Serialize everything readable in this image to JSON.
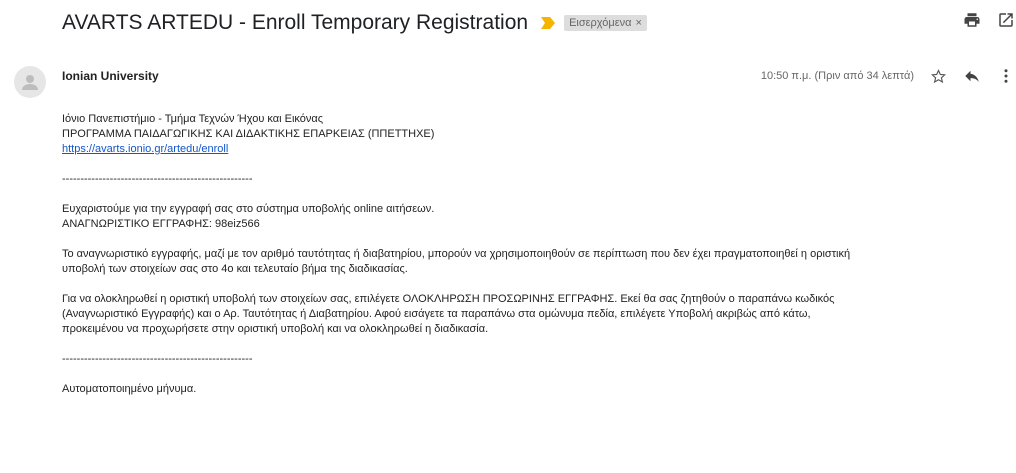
{
  "email": {
    "subject": "AVARTS ARTEDU - Enroll Temporary Registration",
    "label": "Εισερχόμενα",
    "label_close": "×",
    "sender": "Ionian University",
    "time": "10:50 π.μ. (Πριν από 34 λεπτά)"
  },
  "icons": {
    "importance": "importance-marker-icon",
    "print": "print-icon",
    "open_new": "open-in-new-window-icon",
    "star": "star-icon",
    "reply": "reply-icon",
    "more": "more-vert-icon",
    "avatar": "avatar-icon"
  },
  "colors": {
    "link": "#1155cc",
    "importance": "#f4b400",
    "label_bg": "#dddddd"
  },
  "body": {
    "line1": "Ιόνιο Πανεπιστήμιο - Τμήμα Τεχνών Ήχου και Εικόνας",
    "line2": "ΠΡΟΓΡΑΜΜΑ ΠΑΙΔΑΓΩΓΙΚΗΣ ΚΑΙ ΔΙΔΑΚΤΙΚΗΣ ΕΠΑΡΚΕΙΑΣ (ΠΠΕΤΤΗΧΕ)",
    "link": "https://avarts.ionio.gr/artedu/enroll",
    "separator": "----------------------------------------------------",
    "thanks": "Ευχαριστούμε για την εγγραφή σας στο σύστημα υποβολής online αιτήσεων.",
    "reg_id": "ΑΝΑΓΝΩΡΙΣΤΙΚΟ ΕΓΓΡΑΦΗΣ: 98eiz566",
    "para1_l1": "Το αναγνωριστικό εγγραφής, μαζί με τον αριθμό ταυτότητας ή διαβατηρίου, μπορούν να χρησιμοποιηθούν σε περίπτωση που δεν έχει πραγματοποιηθεί η οριστική",
    "para1_l2": "υποβολή των στοιχείων σας στο 4ο και τελευταίο βήμα της διαδικασίας.",
    "para2_l1": "Για να ολοκληρωθεί η οριστική υποβολή των στοιχείων σας, επιλέγετε ΟΛΟΚΛΗΡΩΣΗ ΠΡΟΣΩΡΙΝΗΣ ΕΓΓΡΑΦΗΣ. Εκεί θα σας ζητηθούν ο παραπάνω κωδικός",
    "para2_l2": "(Αναγνωριστικό Εγγραφής) και ο Αρ. Ταυτότητας ή Διαβατηρίου. Αφού εισάγετε τα παραπάνω στα ομώνυμα πεδία, επιλέγετε Υποβολή ακριβώς από κάτω,",
    "para2_l3": "προκειμένου να προχωρήσετε στην οριστική υποβολή και να ολοκληρωθεί η διαδικασία.",
    "separator2": "----------------------------------------------------",
    "auto": "Αυτοματοποιημένο μήνυμα."
  }
}
